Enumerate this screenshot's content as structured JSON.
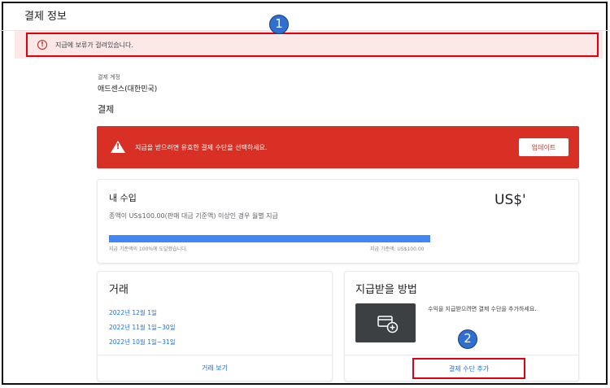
{
  "header": {
    "title": "결제 정보"
  },
  "hold_banner": {
    "message": "지급에 보류가 걸려있습니다.",
    "icon": "error-circle-icon",
    "highlight_color": "#e0000f"
  },
  "annotations": {
    "badge1": "1",
    "badge2": "2"
  },
  "account": {
    "label": "결제 계정",
    "value": "애드센스(대한민국)"
  },
  "payments_section": {
    "title": "결제"
  },
  "alert": {
    "message": "지급을 받으려면 유효한 결제 수단을 선택하세요.",
    "button_label": "업데이트",
    "icon": "warning-triangle-icon",
    "color": "#d93025"
  },
  "earnings": {
    "title": "내 수입",
    "subtitle": "종액이 US$100.00(판매 대금 기준액) 이상인 경우 월별 지급",
    "amount": "US$'",
    "progress_percent": 100,
    "progress_left_label": "지급 기준액의 100%에 도달했습니다.",
    "progress_right_label": "지급 기준액: US$100.00",
    "progress_color": "#4285f4"
  },
  "transactions": {
    "title": "거래",
    "items": [
      "2022년 12월 1일",
      "2022년 11월 1일~30일",
      "2022년 10월 1일~31일"
    ],
    "view_label": "거래 보기"
  },
  "payment_method": {
    "title": "지급받을 방법",
    "description": "수익을 지급받으려면 결제 수단을 추가하세요.",
    "add_label": "결제 수단 추가",
    "icon": "add-card-icon"
  }
}
